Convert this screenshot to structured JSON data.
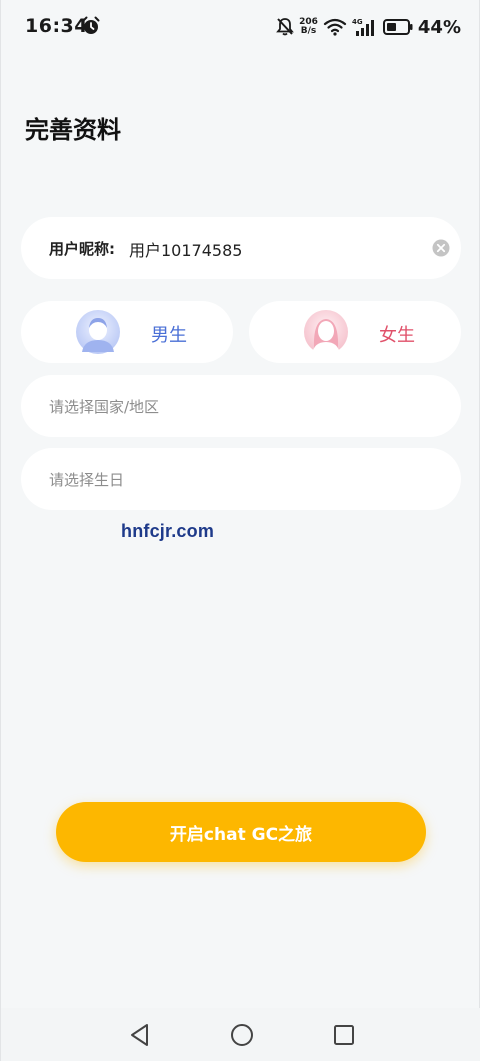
{
  "status_bar": {
    "time": "16:34",
    "net_speed_value": "206",
    "net_speed_unit": "B/s",
    "battery_percent": "44%",
    "icons": [
      "alarm-icon",
      "bell-off-icon",
      "wifi-icon",
      "signal-icon",
      "battery-icon"
    ]
  },
  "page": {
    "title": "完善资料"
  },
  "form": {
    "nickname_label": "用户昵称:",
    "nickname_value": "用户10174585",
    "male_label": "男生",
    "female_label": "女生",
    "country_placeholder": "请选择国家/地区",
    "birthday_placeholder": "请选择生日"
  },
  "watermark": "hnfcjr.com",
  "actions": {
    "start_label": "开启chat GC之旅"
  },
  "colors": {
    "accent": "#fdb700",
    "male": "#4a6fd6",
    "female": "#e0516a"
  }
}
